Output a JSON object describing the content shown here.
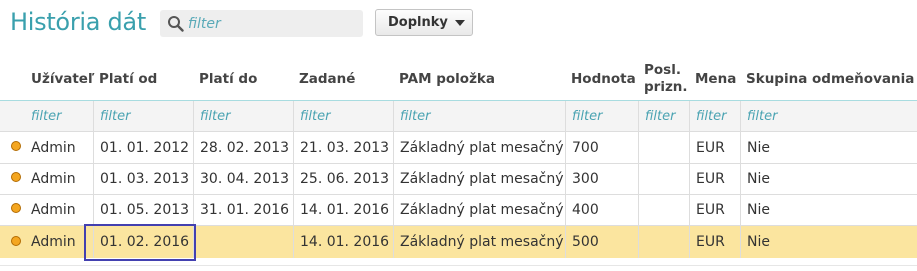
{
  "page": {
    "title": "História dát"
  },
  "search": {
    "placeholder": "filter"
  },
  "toolbar": {
    "dropdown_label": "Doplnky"
  },
  "table": {
    "headers": [
      "Užívateľ",
      "Platí od",
      "Platí do",
      "Zadané",
      "PAM položka",
      "Hodnota",
      "Posl. prizn.",
      "Mena",
      "Skupina odmeňovania"
    ],
    "header_posl_line1": "Posl.",
    "header_posl_line2": "prizn.",
    "filter_placeholder": "filter",
    "rows": [
      [
        "Admin",
        "01. 01. 2012",
        "28. 02. 2013",
        "21. 03. 2013",
        "Základný plat mesačný",
        "700",
        "",
        "EUR",
        "Nie"
      ],
      [
        "Admin",
        "01. 03. 2013",
        "30. 04. 2013",
        "25. 06. 2013",
        "Základný plat mesačný",
        "300",
        "",
        "EUR",
        "Nie"
      ],
      [
        "Admin",
        "01. 05. 2013",
        "31. 01. 2016",
        "14. 01. 2016",
        "Základný plat mesačný",
        "400",
        "",
        "EUR",
        "Nie"
      ],
      [
        "Admin",
        "01. 02. 2016",
        "",
        "14. 01. 2016",
        "Základný plat mesačný",
        "500",
        "",
        "EUR",
        "Nie"
      ]
    ],
    "selected_row": 3
  },
  "colors": {
    "accent": "#3aa0ad",
    "selected_row": "#fbe59f",
    "status_dot": "#f4a620",
    "focus_border": "#4340b0"
  },
  "icons": {
    "search": "search-icon",
    "dropdown": "caret-down-icon",
    "row_status": "status-dot-icon"
  }
}
